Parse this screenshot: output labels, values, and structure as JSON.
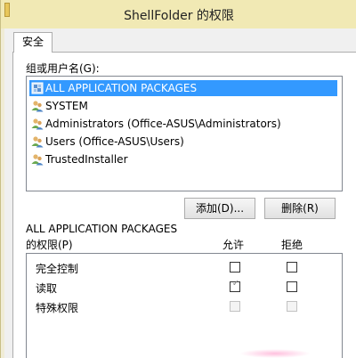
{
  "window": {
    "title": "ShellFolder 的权限"
  },
  "tabs": [
    {
      "label": "安全"
    }
  ],
  "groups": {
    "label": "组或用户名(G):",
    "items": [
      {
        "name": "ALL APPLICATION PACKAGES",
        "icon": "app-packages-icon",
        "selected": true
      },
      {
        "name": "SYSTEM",
        "icon": "users-icon",
        "selected": false
      },
      {
        "name": "Administrators (Office-ASUS\\Administrators)",
        "icon": "users-icon",
        "selected": false
      },
      {
        "name": "Users (Office-ASUS\\Users)",
        "icon": "users-icon",
        "selected": false
      },
      {
        "name": "TrustedInstaller",
        "icon": "users-icon",
        "selected": false
      }
    ]
  },
  "buttons": {
    "add": "添加(D)...",
    "remove": "删除(R)"
  },
  "permissions": {
    "for_label": "ALL APPLICATION PACKAGES",
    "label": "的权限(P)",
    "allow_header": "允许",
    "deny_header": "拒绝",
    "rows": [
      {
        "name": "完全控制",
        "allow": false,
        "deny": false,
        "disabled": false
      },
      {
        "name": "读取",
        "allow": true,
        "deny": false,
        "disabled": false
      },
      {
        "name": "特殊权限",
        "allow": false,
        "deny": false,
        "disabled": true
      }
    ]
  },
  "colors": {
    "selection": "#3399ff",
    "titlebar": "#f1e9b4"
  }
}
